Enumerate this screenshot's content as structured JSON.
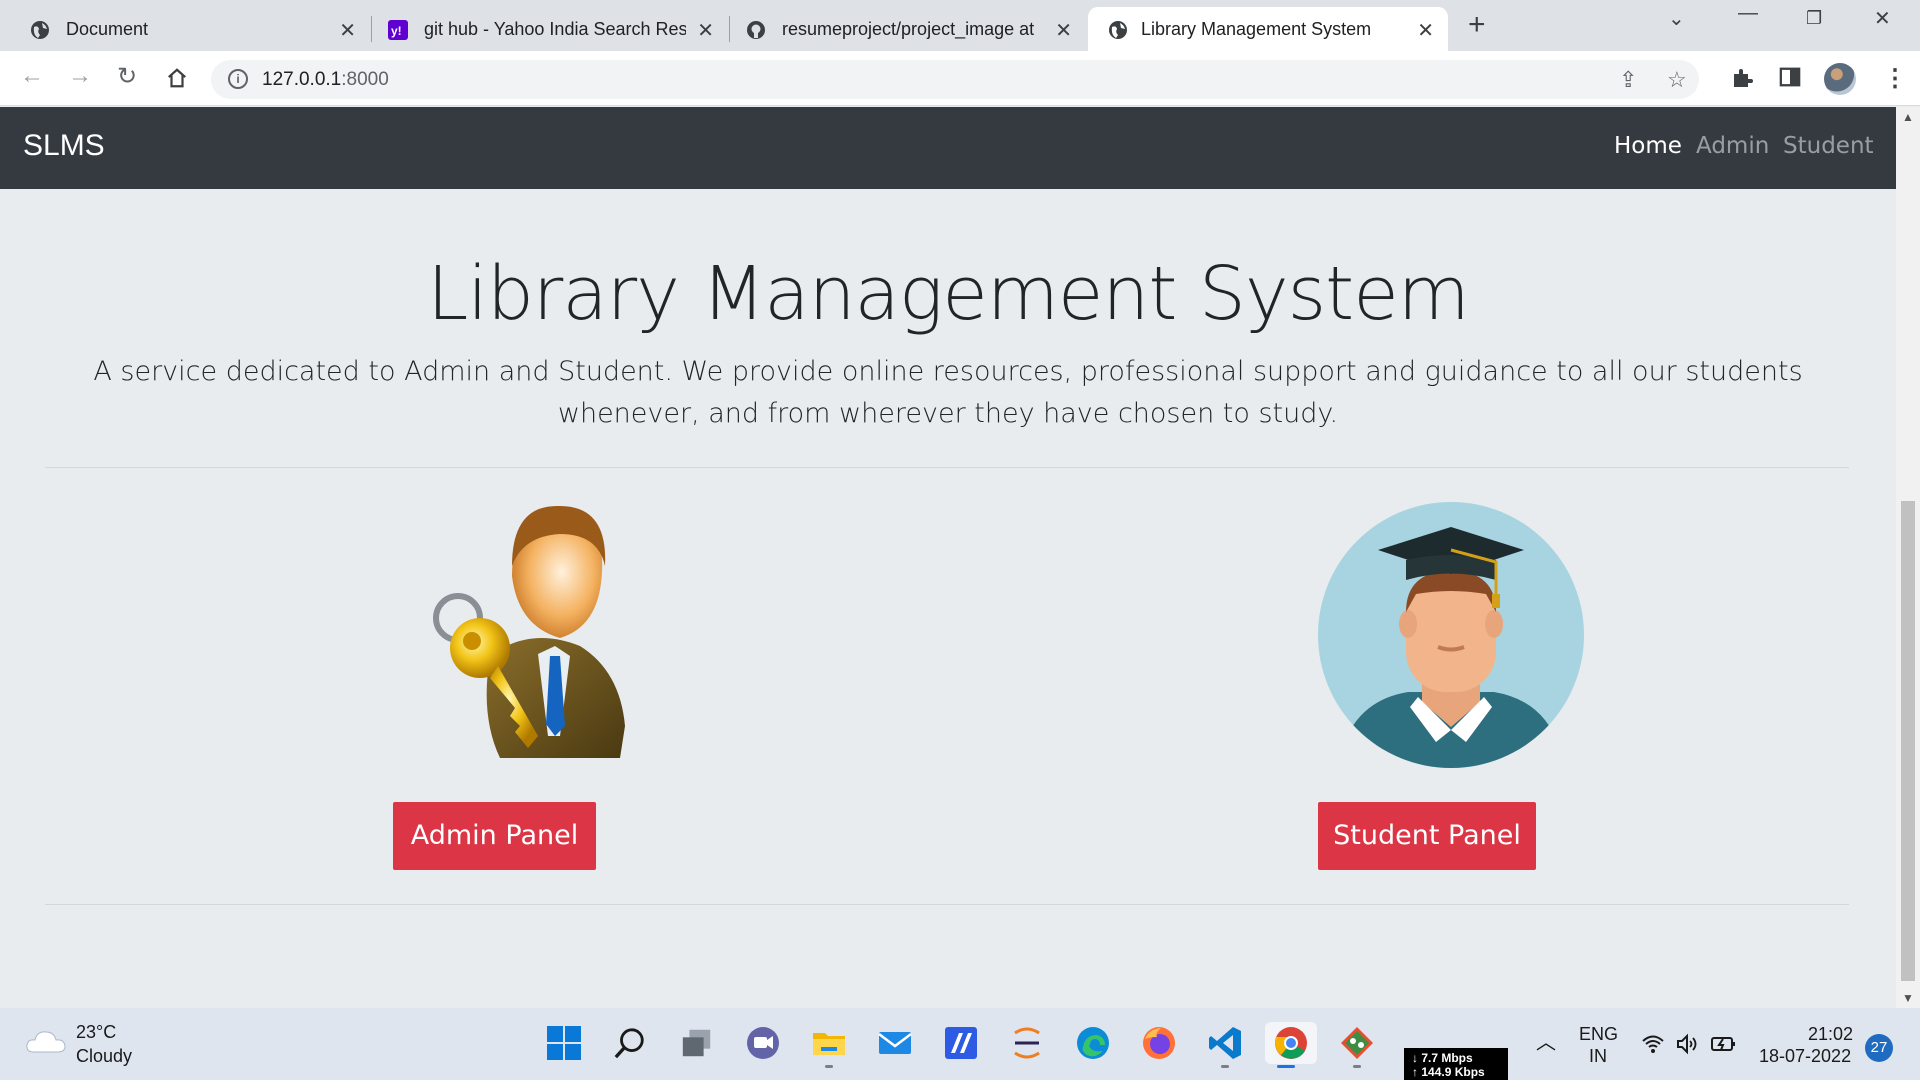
{
  "browser": {
    "tabs": [
      {
        "title": "Document"
      },
      {
        "title": "git hub - Yahoo India Search Resu"
      },
      {
        "title": "resumeproject/project_image at"
      },
      {
        "title": "Library Management System"
      }
    ],
    "url_host": "127.0.0.1",
    "url_port": ":8000"
  },
  "navbar": {
    "brand": "SLMS",
    "links": [
      "Home",
      "Admin",
      "Student"
    ]
  },
  "hero": {
    "title": "Library Management System",
    "lead": "A service dedicated to Admin and Student. We provide online resources, professional support and guidance to all our students whenever, and from wherever they have chosen to study."
  },
  "panels": {
    "admin_button": "Admin Panel",
    "student_button": "Student Panel"
  },
  "taskbar": {
    "weather_temp": "23°C",
    "weather_desc": "Cloudy",
    "net_down": "7.7 Mbps",
    "net_up": "144.9 Kbps",
    "lang_line1": "ENG",
    "lang_line2": "IN",
    "time": "21:02",
    "date": "18-07-2022",
    "notifications": "27"
  },
  "colors": {
    "navbar_bg": "#343a40",
    "page_bg": "#e9ecef",
    "button_danger": "#dc3545"
  }
}
